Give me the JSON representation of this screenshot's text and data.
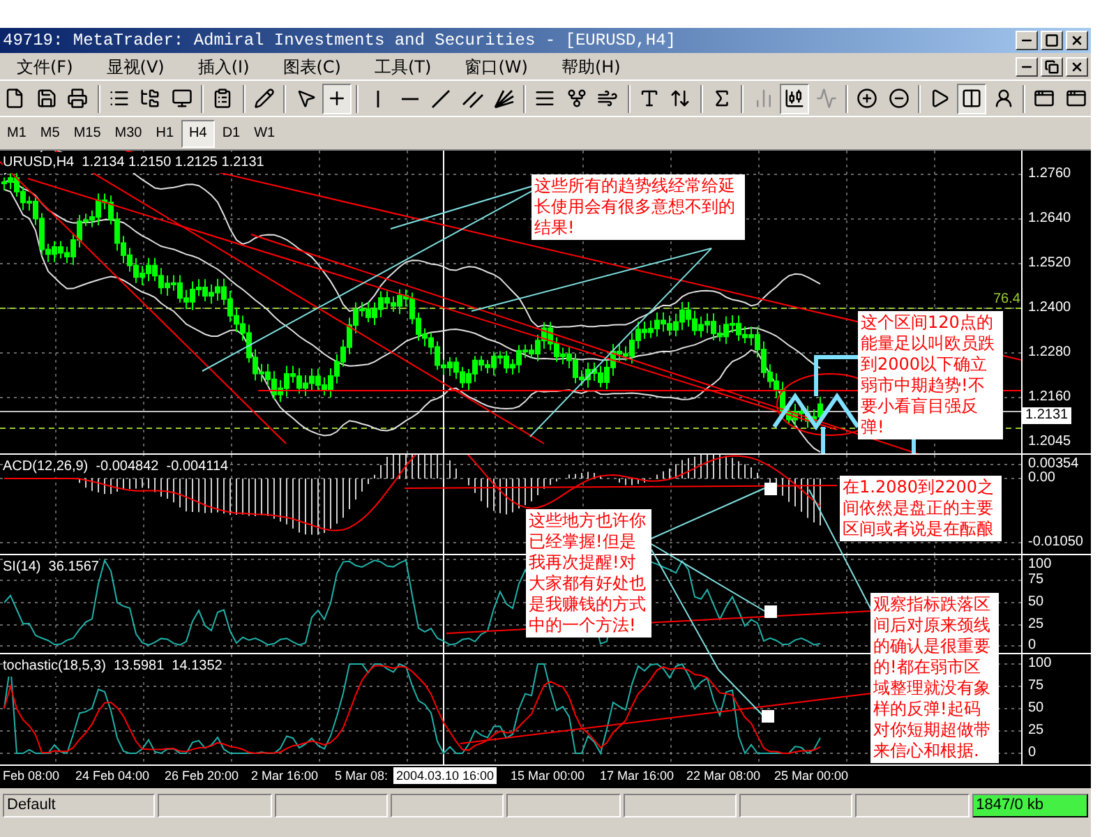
{
  "window": {
    "title": "49719: MetaTrader: Admiral Investments and Securities - [EURUSD,H4]"
  },
  "menu": [
    "文件(F)",
    "显视(V)",
    "插入(I)",
    "图表(C)",
    "工具(T)",
    "窗口(W)",
    "帮助(H)"
  ],
  "toolbar": [
    {
      "kind": "new",
      "pressed": false,
      "disabled": false
    },
    {
      "kind": "save",
      "pressed": false,
      "disabled": false
    },
    {
      "kind": "print",
      "pressed": false,
      "disabled": false
    },
    {
      "kind": "sep"
    },
    {
      "kind": "list",
      "pressed": false,
      "disabled": false
    },
    {
      "kind": "folder",
      "pressed": false,
      "disabled": false
    },
    {
      "kind": "monitor",
      "pressed": false,
      "disabled": false
    },
    {
      "kind": "sep"
    },
    {
      "kind": "properties",
      "pressed": false,
      "disabled": false
    },
    {
      "kind": "sep"
    },
    {
      "kind": "pencil",
      "pressed": false,
      "disabled": false
    },
    {
      "kind": "sep"
    },
    {
      "kind": "cursor",
      "pressed": false,
      "disabled": false
    },
    {
      "kind": "crosshair",
      "pressed": true,
      "disabled": false
    },
    {
      "kind": "sep"
    },
    {
      "kind": "vline",
      "pressed": false,
      "disabled": false
    },
    {
      "kind": "hline",
      "pressed": false,
      "disabled": false
    },
    {
      "kind": "trend",
      "pressed": false,
      "disabled": false
    },
    {
      "kind": "channel",
      "pressed": false,
      "disabled": false
    },
    {
      "kind": "fan",
      "pressed": false,
      "disabled": false
    },
    {
      "kind": "sep"
    },
    {
      "kind": "fibo",
      "pressed": false,
      "disabled": false
    },
    {
      "kind": "fork",
      "pressed": false,
      "disabled": false
    },
    {
      "kind": "wind",
      "pressed": false,
      "disabled": false
    },
    {
      "kind": "sep"
    },
    {
      "kind": "text",
      "pressed": false,
      "disabled": false
    },
    {
      "kind": "arrows",
      "pressed": false,
      "disabled": false
    },
    {
      "kind": "sep"
    },
    {
      "kind": "function",
      "pressed": false,
      "disabled": false
    },
    {
      "kind": "sep"
    },
    {
      "kind": "bars",
      "pressed": false,
      "disabled": true
    },
    {
      "kind": "candles",
      "pressed": true,
      "disabled": false
    },
    {
      "kind": "line",
      "pressed": false,
      "disabled": true
    },
    {
      "kind": "sep"
    },
    {
      "kind": "zoomin",
      "pressed": false,
      "disabled": false
    },
    {
      "kind": "zoomout",
      "pressed": false,
      "disabled": false
    },
    {
      "kind": "sep"
    },
    {
      "kind": "scroll",
      "pressed": false,
      "disabled": false
    },
    {
      "kind": "separators",
      "pressed": true,
      "disabled": false
    },
    {
      "kind": "expert",
      "pressed": false,
      "disabled": false
    },
    {
      "kind": "sep"
    },
    {
      "kind": "window",
      "pressed": false,
      "disabled": false
    },
    {
      "kind": "window",
      "pressed": false,
      "disabled": false
    }
  ],
  "timeframes": [
    {
      "label": "M1",
      "selected": false
    },
    {
      "label": "M5",
      "selected": false
    },
    {
      "label": "M15",
      "selected": false
    },
    {
      "label": "M30",
      "selected": false
    },
    {
      "label": "H1",
      "selected": false
    },
    {
      "label": "H4",
      "selected": true
    },
    {
      "label": "D1",
      "selected": false
    },
    {
      "label": "W1",
      "selected": false
    }
  ],
  "chart": {
    "price_panel": {
      "legend": "URUSD,H4  1.2134 1.2150 1.2125 1.2131",
      "axis": [
        "1.2760",
        "1.2640",
        "1.2520",
        "1.2400",
        "1.2280",
        "1.2160",
        "1.2045"
      ],
      "current_price": "1.2131",
      "level_label": "76.4"
    },
    "indicators": [
      {
        "kind": "macd",
        "legend": "ACD(12,26,9)  -0.004842  -0.004114",
        "axis": [
          "0.00354",
          "0.00",
          "-0.01050"
        ]
      },
      {
        "kind": "rsi",
        "legend": "SI(14)  36.1567",
        "axis": [
          "100",
          "75",
          "50",
          "25",
          "0"
        ]
      },
      {
        "kind": "stochastic",
        "legend": "tochastic(18,5,3)  13.5981  14.1352",
        "axis": [
          "100",
          "75",
          "50",
          "25",
          "0"
        ]
      }
    ],
    "time_axis": [
      {
        "kind": "tick",
        "label": "Feb 08:00"
      },
      {
        "kind": "tick",
        "label": "24 Feb 04:00"
      },
      {
        "kind": "tick",
        "label": "26 Feb 20:00"
      },
      {
        "kind": "tick",
        "label": "2 Mar 16:00"
      },
      {
        "kind": "tick",
        "label": "5 Mar 08:"
      },
      {
        "kind": "cursor",
        "label": "2004.03.10 16:00"
      },
      {
        "kind": "tick",
        "label": "15 Mar 00:00"
      },
      {
        "kind": "tick",
        "label": "17 Mar 16:00"
      },
      {
        "kind": "tick",
        "label": "22 Mar 08:00"
      },
      {
        "kind": "tick",
        "label": "25 Mar 00:00"
      }
    ],
    "notes": [
      "这些所有的趋势线经常给延长使用会有很多意想不到的结果!",
      "这个区间120点的能量足以叫欧员跌到2000以下确立弱市中期趋势!不要小看盲目强反弹!",
      "在1.2080到2200之间依然是盘正的主要区间或者说是在酝酿",
      "这些地方也许你已经掌握!但是我再次提醒!对大家都有好处也是我赚钱的方式中的一个方法!",
      "观察指标跌落区间后对原来颈线的确认是很重要的!都在弱市区域整理就没有象样的反弹!起码对你短期超做带来信心和根据."
    ]
  },
  "status_bar": {
    "profile": "Default",
    "traffic": "1847/0 kb"
  }
}
